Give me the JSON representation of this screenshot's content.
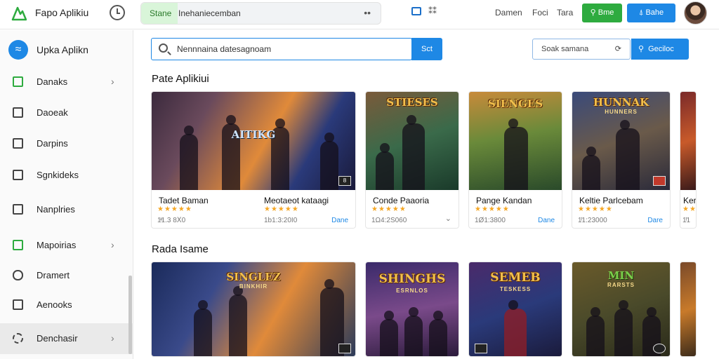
{
  "app": {
    "title": "Fapo Aplikiu"
  },
  "top_search": {
    "pill": "Stane",
    "text": "Inehaniecemban",
    "more": "••"
  },
  "toolbar": {
    "tool_text": "⁑⁑"
  },
  "nav": {
    "links": [
      "Damen",
      "Foci",
      "Tara"
    ]
  },
  "buttons": {
    "green": "Bme",
    "blue": "Bahe"
  },
  "sidebar": {
    "brand": "Upka Aplikn",
    "items": [
      {
        "label": "Danaks",
        "chevron": "›"
      },
      {
        "label": "Daoeak",
        "chevron": ""
      },
      {
        "label": "Darpins",
        "chevron": ""
      },
      {
        "label": "Sgnkideks",
        "chevron": ""
      },
      {
        "label": "Nanplries",
        "chevron": ""
      },
      {
        "label": "Mapoirias",
        "chevron": "›"
      },
      {
        "label": "Dramert",
        "chevron": ""
      },
      {
        "label": "Aenooks",
        "chevron": ""
      },
      {
        "label": "Denchasir",
        "chevron": "›"
      }
    ]
  },
  "main_search": {
    "value": "Nennnaina datesagnoam",
    "button": "Sct"
  },
  "filter": {
    "value": "Soak samana",
    "button": "Geciloc"
  },
  "sections": {
    "apps": "Pate Aplikiui",
    "games": "Rada Isame"
  },
  "apps_row": [
    {
      "title": "Tadet Baman",
      "art_label": "AITIKG",
      "art_sub": "",
      "stars": "★★★★★",
      "meta": "1ͣ1.3 8Ⅹ0",
      "action": "Dane",
      "badge": "8"
    },
    {
      "title": "Meotaeot kataagi",
      "art_label": "",
      "art_sub": "",
      "stars": "★★★★★",
      "meta": "1b1:3:20I0",
      "action": "",
      "badge": ""
    },
    {
      "title": "Conde Paaoria",
      "art_label": "STIESES",
      "art_sub": "",
      "stars": "★★★★★",
      "meta": "1Ω4:2S060",
      "action": "⌄",
      "badge": ""
    },
    {
      "title": "Pange Kandan",
      "art_label": "SIENGES",
      "art_sub": "",
      "stars": "★★★★★",
      "meta": "1Ø1:3800",
      "action": "Dane",
      "badge": ""
    },
    {
      "title": "Keltie Parlcebam",
      "art_label": "HUNNAK",
      "art_sub": "HUNNERS",
      "stars": "★★★★★",
      "meta": "1ͭ1:23000",
      "action": "Dare",
      "badge": ""
    },
    {
      "title": "Ker",
      "art_label": "",
      "art_sub": "",
      "stars": "★★",
      "meta": "1ͭ1",
      "action": "",
      "badge": ""
    }
  ],
  "games_row": [
    {
      "title": "",
      "art_label": "SINGLEZ",
      "art_sub": "BINKHIR"
    },
    {
      "title": "",
      "art_label": "SHINGHS",
      "art_sub": "ESRNLOS"
    },
    {
      "title": "",
      "art_label": "SEMEB",
      "art_sub": "TESKESS"
    },
    {
      "title": "",
      "art_label": "MIN",
      "art_sub": "RARSTS"
    },
    {
      "title": "",
      "art_label": "",
      "art_sub": ""
    }
  ],
  "colors": {
    "accent": "#1e88e5",
    "green": "#2eab3f",
    "star": "#f5a623"
  },
  "icons": [
    "logo-icon",
    "clock-icon",
    "search-icon",
    "share-icon",
    "chevron-right-icon",
    "chevron-down-icon",
    "gear-icon",
    "grid-icon",
    "avatar"
  ]
}
